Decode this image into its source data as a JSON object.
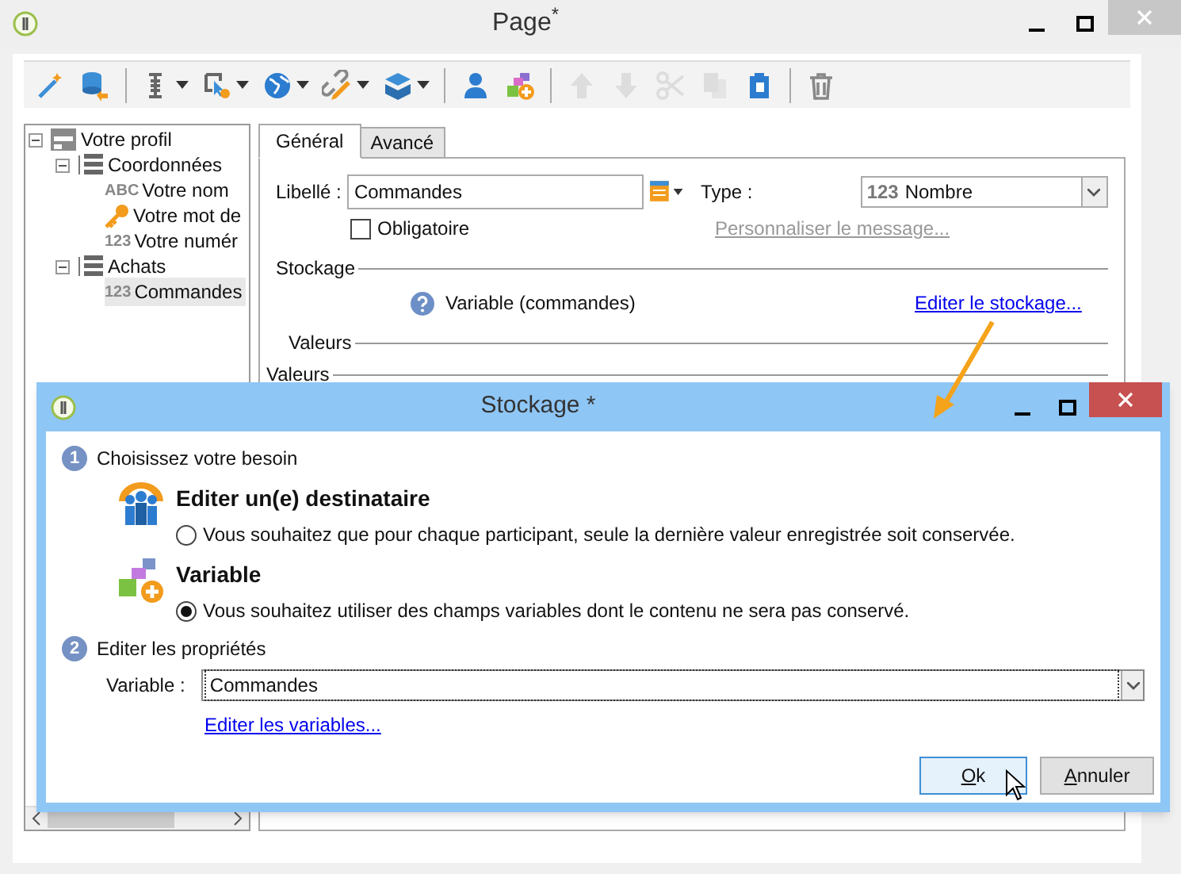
{
  "window": {
    "title": "Page$^{*}$"
  },
  "toolbar": [
    [
      {
        "disabled": false,
        "dropdown": false
      },
      {
        "disabled": false,
        "dropdown": false
      }
    ],
    [
      {
        "disabled": false,
        "dropdown": true
      },
      {
        "disabled": false,
        "dropdown": true
      },
      {
        "disabled": false,
        "dropdown": true
      },
      {
        "disabled": false,
        "dropdown": true
      },
      {
        "disabled": false,
        "dropdown": true
      }
    ],
    [
      {
        "disabled": false,
        "dropdown": false
      },
      {
        "disabled": false,
        "dropdown": false
      }
    ],
    [
      {
        "disabled": true,
        "dropdown": false
      },
      {
        "disabled": true,
        "dropdown": false
      },
      {
        "disabled": true,
        "dropdown": false
      },
      {
        "disabled": true,
        "dropdown": false
      },
      {
        "disabled": false,
        "dropdown": false
      }
    ],
    [
      {
        "disabled": false,
        "dropdown": false
      }
    ]
  ],
  "tree": [
    {
      "label": "Votre profil",
      "kind": "form",
      "expanded": true,
      "selected": false,
      "children": [
        {
          "label": "Coordonnées",
          "kind": "group",
          "expanded": true,
          "selected": false,
          "children": [
            {
              "label": "Votre nom",
              "kind": "badge",
              "badge": "ABC",
              "selected": false
            },
            {
              "label": "Votre mot de",
              "kind": "key",
              "selected": false
            },
            {
              "label": "Votre numér",
              "kind": "badge",
              "badge": "123",
              "selected": false
            }
          ]
        },
        {
          "label": "Achats",
          "kind": "group",
          "expanded": true,
          "selected": false,
          "children": [
            {
              "label": "Commandes",
              "kind": "badge",
              "badge": "123",
              "selected": true
            }
          ]
        }
      ]
    }
  ],
  "tabs": [
    {
      "label": "Général",
      "selected": true
    },
    {
      "label": "Avancé",
      "selected": false
    }
  ],
  "form": {
    "label_caption": "Libellé :",
    "label_value": "Commandes",
    "type_caption": "Type :",
    "type_prefix": "123",
    "type_value": "Nombre",
    "mandatory": {
      "label": "Obligatoire",
      "checked": false
    },
    "custom_message": {
      "label": "Personnaliser le message...",
      "disabled": true
    },
    "storage": {
      "legend": "Stockage",
      "value": "Variable (commandes)",
      "link": "Editer le stockage..."
    },
    "sections": [
      "Valeurs",
      "Valeurs"
    ]
  },
  "dialog": {
    "title": "Stockage *",
    "step1": {
      "number": "1",
      "label": "Choisissez votre besoin"
    },
    "options": [
      {
        "kind": "recipient",
        "title": "Editer un(e) destinataire",
        "text": "Vous souhaitez que pour chaque participant, seule la dernière valeur enregistrée soit conservée.",
        "selected": false
      },
      {
        "kind": "variable",
        "title": "Variable",
        "text": "Vous souhaitez utiliser des champs variables dont le contenu ne sera pas conservé.",
        "selected": true
      }
    ],
    "step2": {
      "number": "2",
      "label": "Editer les propriétés"
    },
    "variable_caption": "Variable :",
    "variable_value": "Commandes",
    "link": "Editer les variables...",
    "buttons": [
      "Ok",
      "Annuler"
    ]
  }
}
